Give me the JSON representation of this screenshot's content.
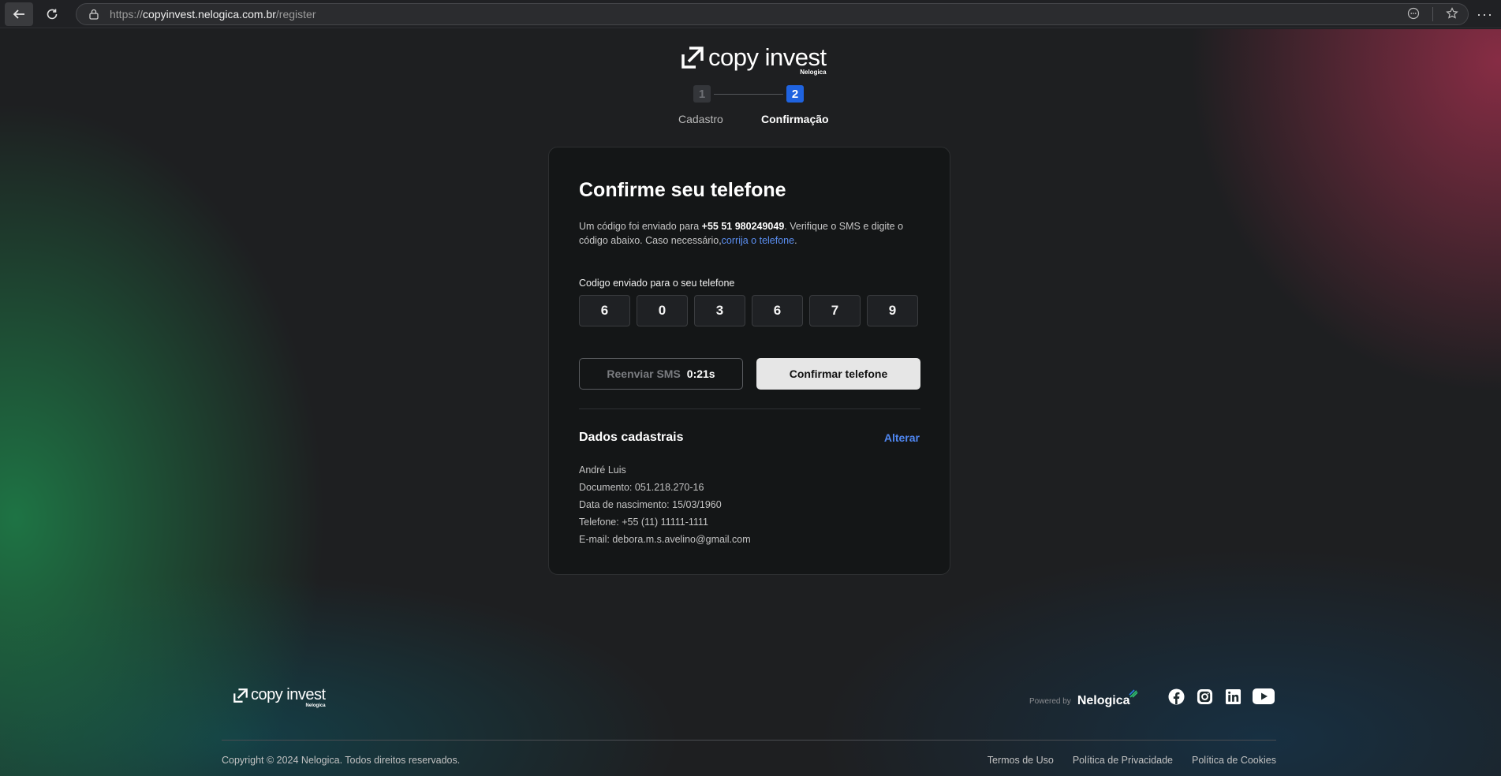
{
  "browser": {
    "url_scheme": "https://",
    "url_host": "copyinvest.nelogica.com.br",
    "url_path": "/register"
  },
  "brand": {
    "name": "copy invest",
    "sub": "Nelogica"
  },
  "stepper": {
    "steps": [
      {
        "number": "1",
        "label": "Cadastro"
      },
      {
        "number": "2",
        "label": "Confirmação"
      }
    ]
  },
  "card": {
    "title": "Confirme seu telefone",
    "desc_prefix": "Um código foi enviado para ",
    "phone": "+55 51 980249049",
    "desc_middle": ". Verifique o SMS e digite o código abaixo. Caso necessário,",
    "desc_link": "corrija o telefone",
    "desc_suffix": ".",
    "code_label": "Codigo enviado para o seu telefone",
    "code_digits": [
      "6",
      "0",
      "3",
      "6",
      "7",
      "9"
    ],
    "resend_label": "Reenviar SMS",
    "resend_timer": "0:21s",
    "confirm_label": "Confirmar telefone",
    "section_title": "Dados cadastrais",
    "section_link": "Alterar",
    "details": [
      "André Luis",
      "Documento: 051.218.270-16",
      "Data de nascimento: 15/03/1960",
      "Telefone: +55 (11) 11111-1111",
      "E-mail: debora.m.s.avelino@gmail.com"
    ]
  },
  "footer": {
    "powered_by": "Powered by",
    "powered_brand": "Nelogica",
    "socials": [
      "facebook-icon",
      "instagram-icon",
      "linkedin-icon",
      "youtube-icon"
    ],
    "copyright": "Copyright © 2024 Nelogica. Todos direitos reservados.",
    "links": [
      "Termos de Uso",
      "Política de Privacidade",
      "Política de Cookies"
    ]
  },
  "colors": {
    "accent": "#1f63e0",
    "link": "#5b8ff2",
    "card_bg": "#141617"
  }
}
